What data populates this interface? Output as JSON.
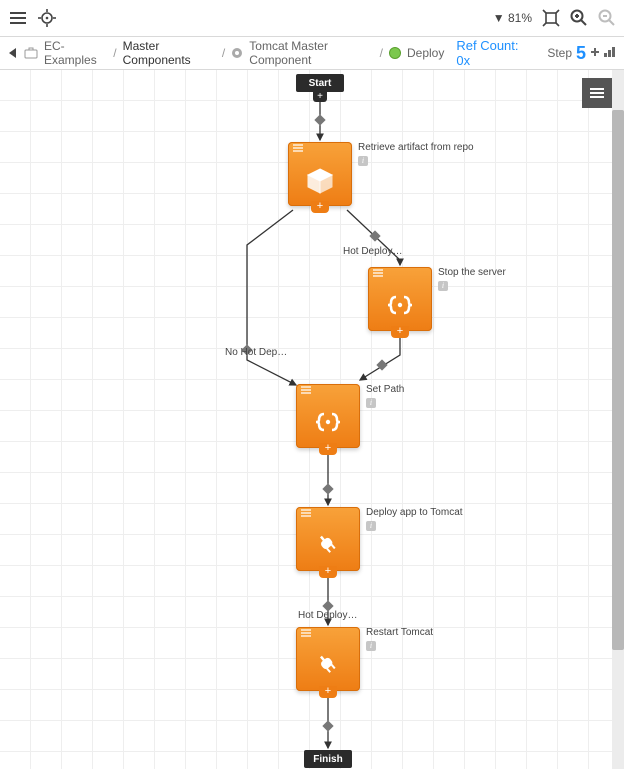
{
  "toolbar": {
    "zoom": "81%",
    "zoom_prefix": "▼"
  },
  "breadcrumb": {
    "items": [
      "EC-Examples",
      "Master Components",
      "Tomcat Master Component",
      "Deploy"
    ]
  },
  "ref_count": "Ref Count: 0x",
  "step_label": "Step",
  "step_value": "5",
  "flow": {
    "start": "Start",
    "finish": "Finish",
    "steps": [
      {
        "label": "Retrieve artifact from repo",
        "icon": "cube"
      },
      {
        "label": "Stop the server",
        "icon": "braces"
      },
      {
        "label": "Set Path",
        "icon": "braces"
      },
      {
        "label": "Deploy app to Tomcat",
        "icon": "plug"
      },
      {
        "label": "Restart Tomcat",
        "icon": "plug"
      }
    ],
    "edges": {
      "hot_deploy": "Hot Deploy…",
      "no_hot_deploy": "No Hot Dep…",
      "hot_deploy2": "Hot Deploy…"
    }
  }
}
